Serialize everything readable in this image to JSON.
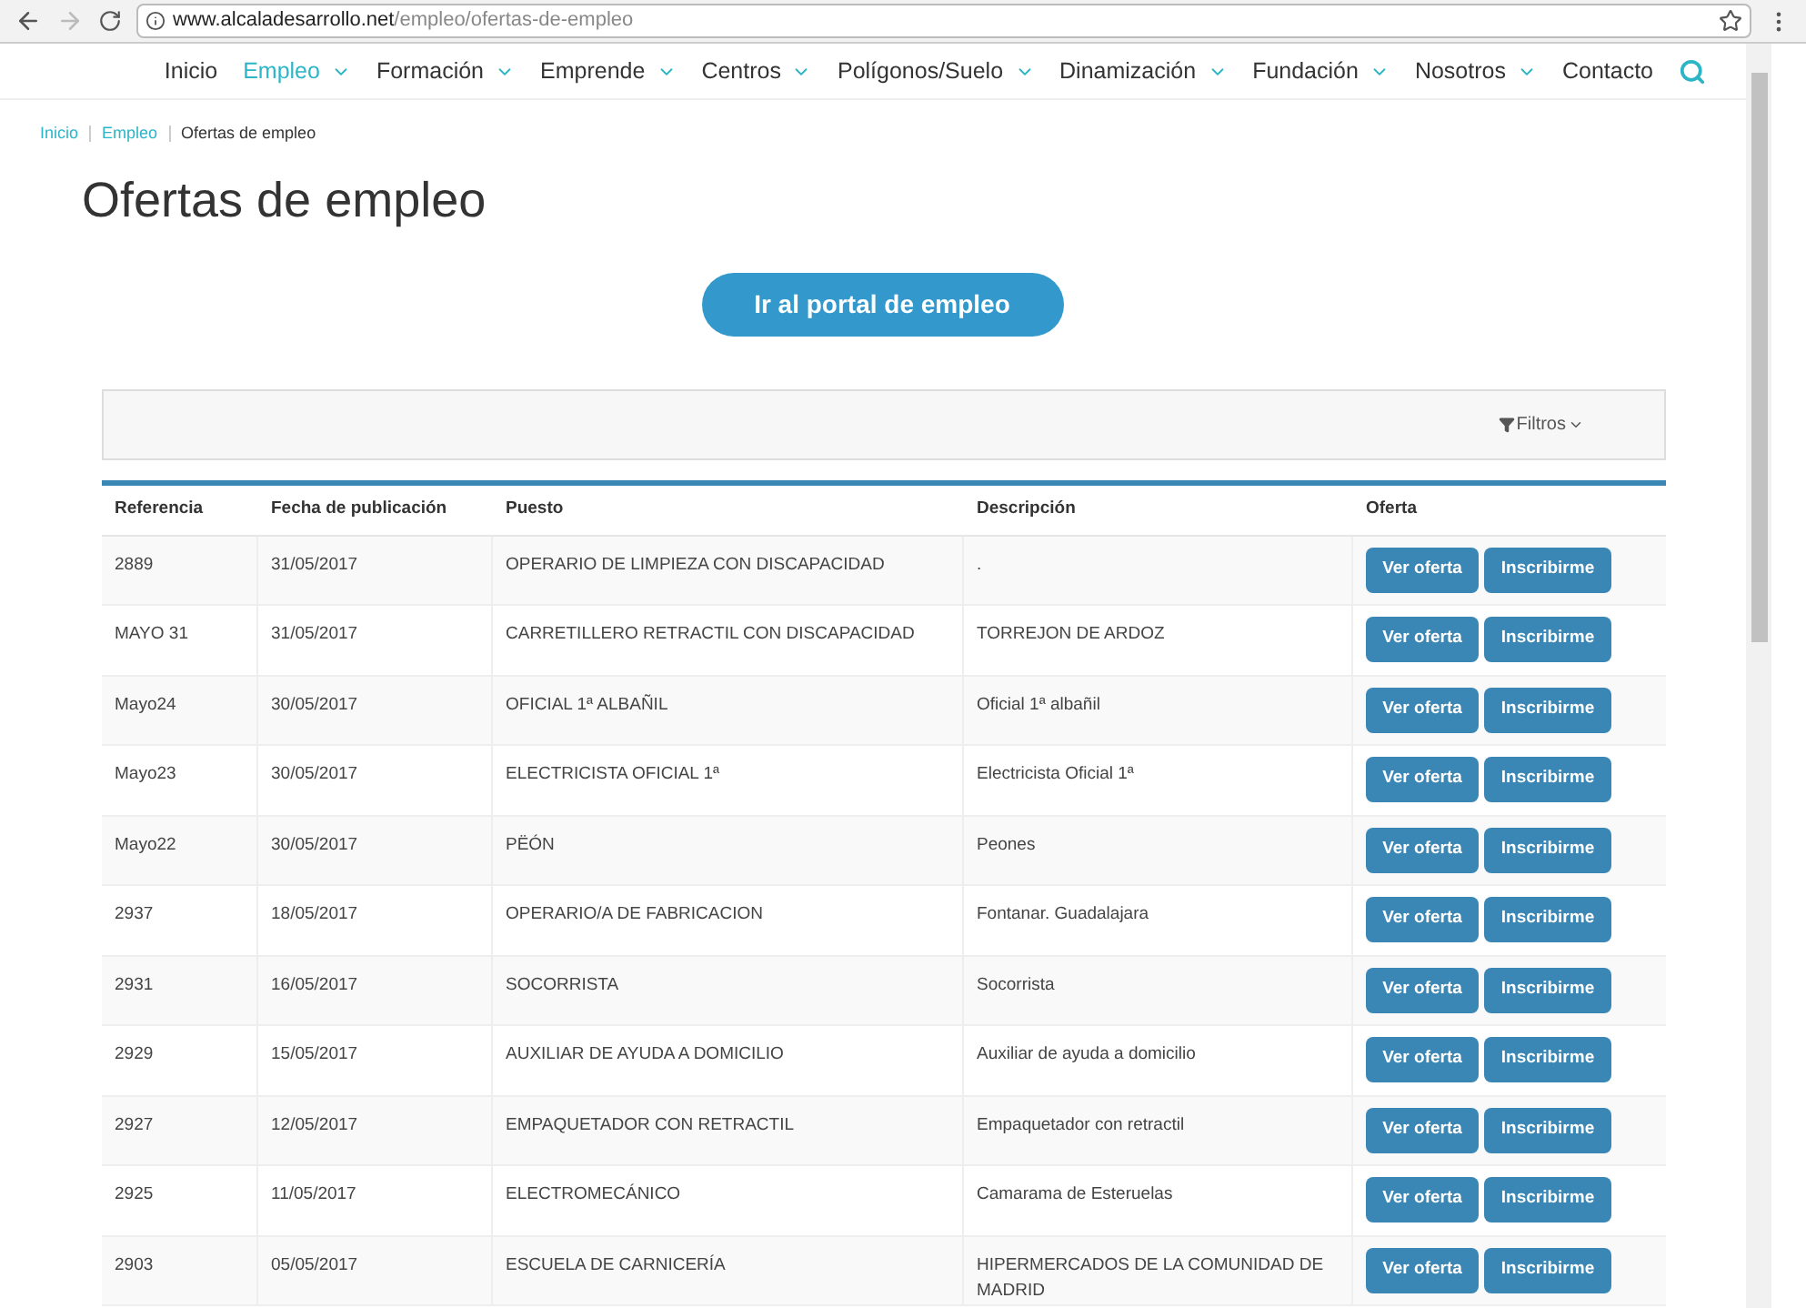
{
  "browser": {
    "url_host": "www.alcaladesarrollo.net",
    "url_path": "/empleo/ofertas-de-empleo"
  },
  "nav": {
    "items": [
      {
        "label": "Inicio",
        "selected": false,
        "dropdown": false
      },
      {
        "label": "Empleo",
        "selected": true,
        "dropdown": true
      },
      {
        "label": "Formación",
        "selected": false,
        "dropdown": true
      },
      {
        "label": "Emprende",
        "selected": false,
        "dropdown": true
      },
      {
        "label": "Centros",
        "selected": false,
        "dropdown": true
      },
      {
        "label": "Polígonos/Suelo",
        "selected": false,
        "dropdown": true
      },
      {
        "label": "Dinamización",
        "selected": false,
        "dropdown": true
      },
      {
        "label": "Fundación",
        "selected": false,
        "dropdown": true
      },
      {
        "label": "Nosotros",
        "selected": false,
        "dropdown": true
      },
      {
        "label": "Contacto",
        "selected": false,
        "dropdown": false
      }
    ]
  },
  "breadcrumb": [
    "Inicio",
    "Empleo",
    "Ofertas de empleo"
  ],
  "title": "Ofertas de empleo",
  "portal_button": "Ir al portal de empleo",
  "filters_button": "Filtros",
  "table": {
    "columns": [
      "Referencia",
      "Fecha de publicación",
      "Puesto",
      "Descripción",
      "Oferta"
    ],
    "rows": [
      {
        "ref": "2889",
        "date": "31/05/2017",
        "job": "OPERARIO DE LIMPIEZA CON DISCAPACIDAD",
        "desc": ".",
        "view": "Ver oferta",
        "apply": "Inscribirme"
      },
      {
        "ref": "MAYO 31",
        "date": "31/05/2017",
        "job": "CARRETILLERO RETRACTIL CON DISCAPACIDAD",
        "desc": "TORREJON DE ARDOZ",
        "view": "Ver oferta",
        "apply": "Inscribirme"
      },
      {
        "ref": "Mayo24",
        "date": "30/05/2017",
        "job": "OFICIAL 1ª ALBAÑIL",
        "desc": "Oficial 1ª albañil",
        "view": "Ver oferta",
        "apply": "Inscribirme"
      },
      {
        "ref": "Mayo23",
        "date": "30/05/2017",
        "job": "ELECTRICISTA OFICIAL 1ª",
        "desc": "Electricista Oficial 1ª",
        "view": "Ver oferta",
        "apply": "Inscribirme"
      },
      {
        "ref": "Mayo22",
        "date": "30/05/2017",
        "job": "PËÓN",
        "desc": "Peones",
        "view": "Ver oferta",
        "apply": "Inscribirme"
      },
      {
        "ref": "2937",
        "date": "18/05/2017",
        "job": "OPERARIO/A DE FABRICACION",
        "desc": "Fontanar. Guadalajara",
        "view": "Ver oferta",
        "apply": "Inscribirme"
      },
      {
        "ref": "2931",
        "date": "16/05/2017",
        "job": "SOCORRISTA",
        "desc": "Socorrista",
        "view": "Ver oferta",
        "apply": "Inscribirme"
      },
      {
        "ref": "2929",
        "date": "15/05/2017",
        "job": "AUXILIAR DE AYUDA A DOMICILIO",
        "desc": "Auxiliar de ayuda a domicilio",
        "view": "Ver oferta",
        "apply": "Inscribirme"
      },
      {
        "ref": "2927",
        "date": "12/05/2017",
        "job": "EMPAQUETADOR CON RETRACTIL",
        "desc": "Empaquetador con retractil",
        "view": "Ver oferta",
        "apply": "Inscribirme"
      },
      {
        "ref": "2925",
        "date": "11/05/2017",
        "job": "ELECTROMECÁNICO",
        "desc": "Camarama de Esteruelas",
        "view": "Ver oferta",
        "apply": "Inscribirme"
      },
      {
        "ref": "2903",
        "date": "05/05/2017",
        "job": "ESCUELA DE CARNICERÍA",
        "desc": "HIPERMERCADOS DE LA COMUNIDAD DE MADRID",
        "view": "Ver oferta",
        "apply": "Inscribirme"
      }
    ]
  }
}
